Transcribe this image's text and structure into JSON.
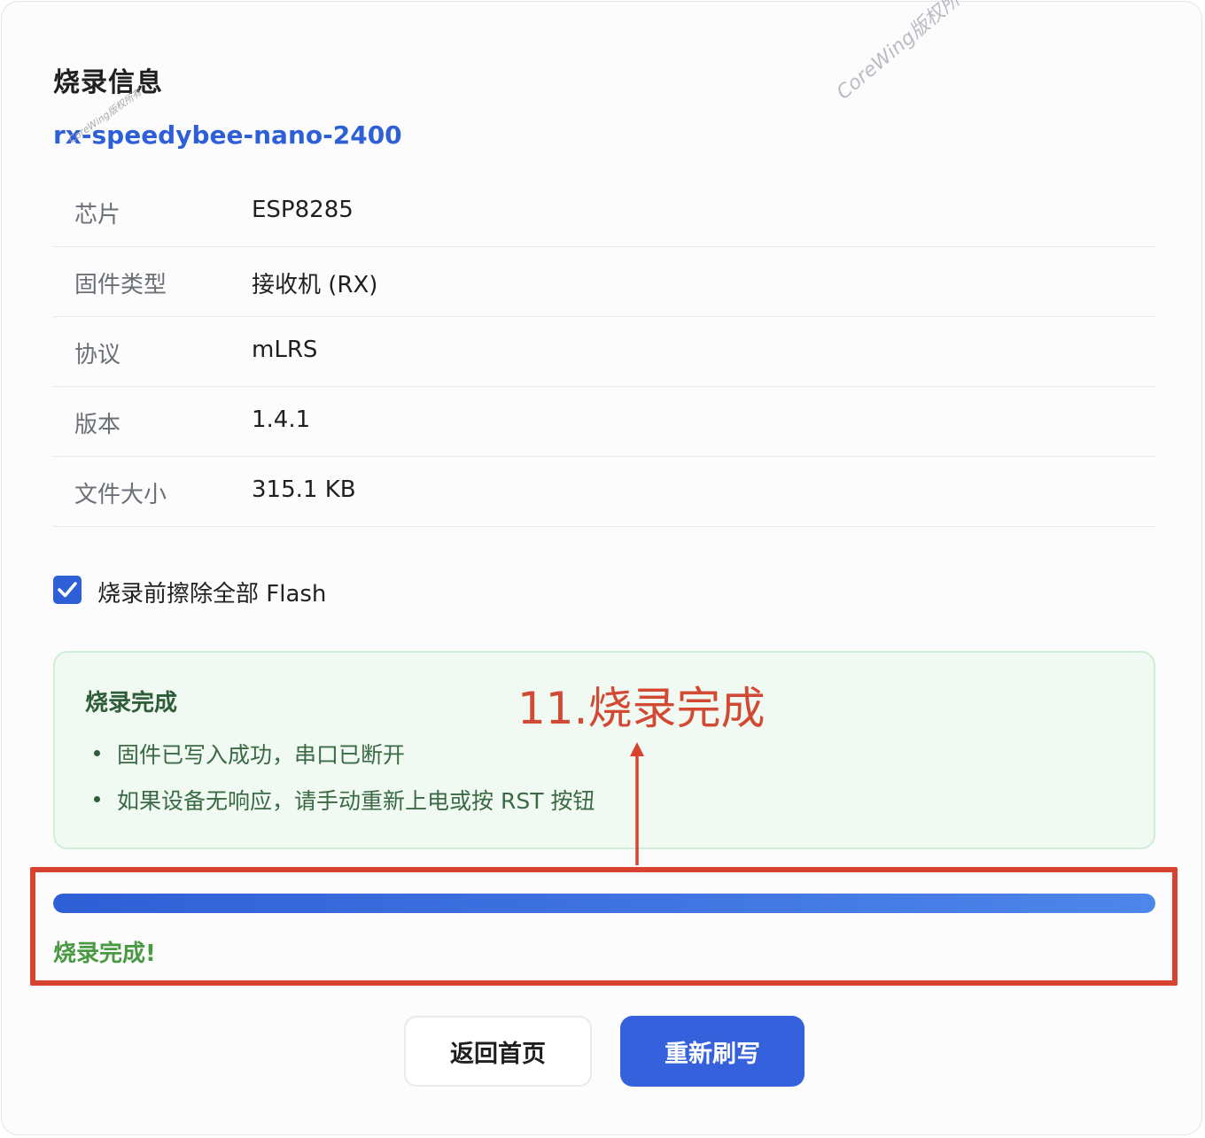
{
  "header": {
    "title": "烧录信息",
    "device_name": "rx-speedybee-nano-2400"
  },
  "watermarks": {
    "small": "CoreWing版权所有",
    "large": "CoreWing版权所"
  },
  "info": [
    {
      "label": "芯片",
      "value": "ESP8285"
    },
    {
      "label": "固件类型",
      "value": "接收机 (RX)"
    },
    {
      "label": "协议",
      "value": "mLRS"
    },
    {
      "label": "版本",
      "value": "1.4.1"
    },
    {
      "label": "文件大小",
      "value": "315.1 KB"
    }
  ],
  "erase_option": {
    "label": "烧录前擦除全部 Flash",
    "checked": true
  },
  "success": {
    "title": "烧录完成",
    "items": [
      "固件已写入成功，串口已断开",
      "如果设备无响应，请手动重新上电或按 RST 按钮"
    ]
  },
  "annotation": {
    "label": "11.烧录完成",
    "color": "#d8432f"
  },
  "progress": {
    "value": 1.0,
    "status_text": "烧录完成!"
  },
  "buttons": {
    "home_label": "返回首页",
    "reflash_label": "重新刷写"
  },
  "colors": {
    "accent": "#3561dc",
    "success_bg": "#f1faf2",
    "success_text": "#4a9a44"
  }
}
